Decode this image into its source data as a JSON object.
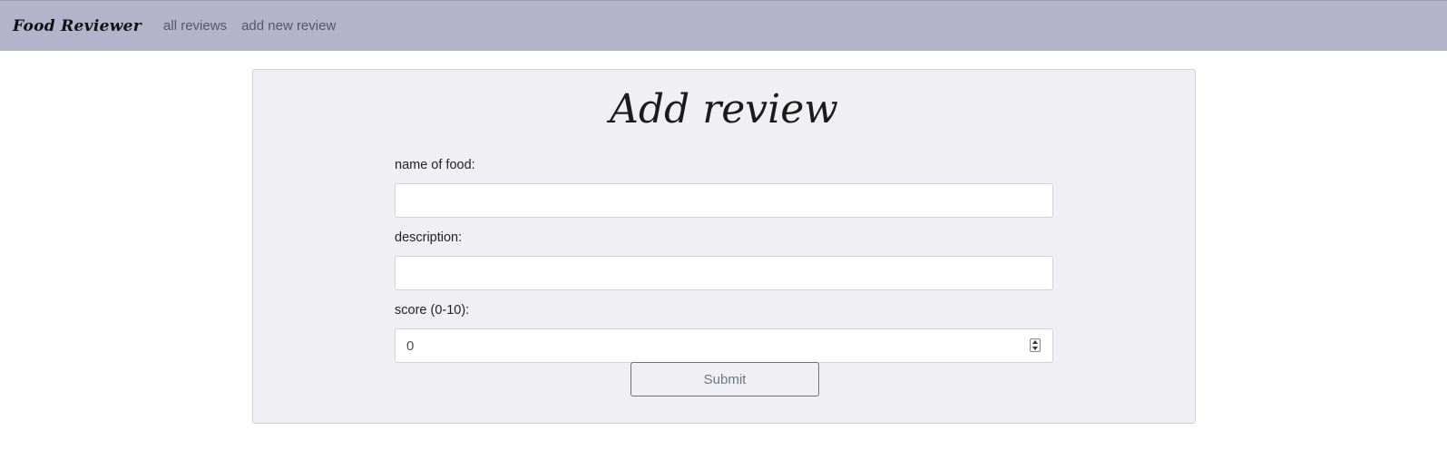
{
  "navbar": {
    "brand": "Food Reviewer",
    "links": [
      {
        "label": "all reviews"
      },
      {
        "label": "add new review"
      }
    ]
  },
  "page": {
    "title": "Add review"
  },
  "form": {
    "name_label": "name of food:",
    "name_value": "",
    "description_label": "description:",
    "description_value": "",
    "score_label": "score (0-10):",
    "score_value": "0",
    "submit_label": "Submit"
  },
  "colors": {
    "navbar_bg": "#b3b3cc",
    "card_bg": "#f0eff4",
    "button_border": "#6c757d"
  },
  "icons": {
    "score_spinner": "spinner-arrows-icon"
  }
}
